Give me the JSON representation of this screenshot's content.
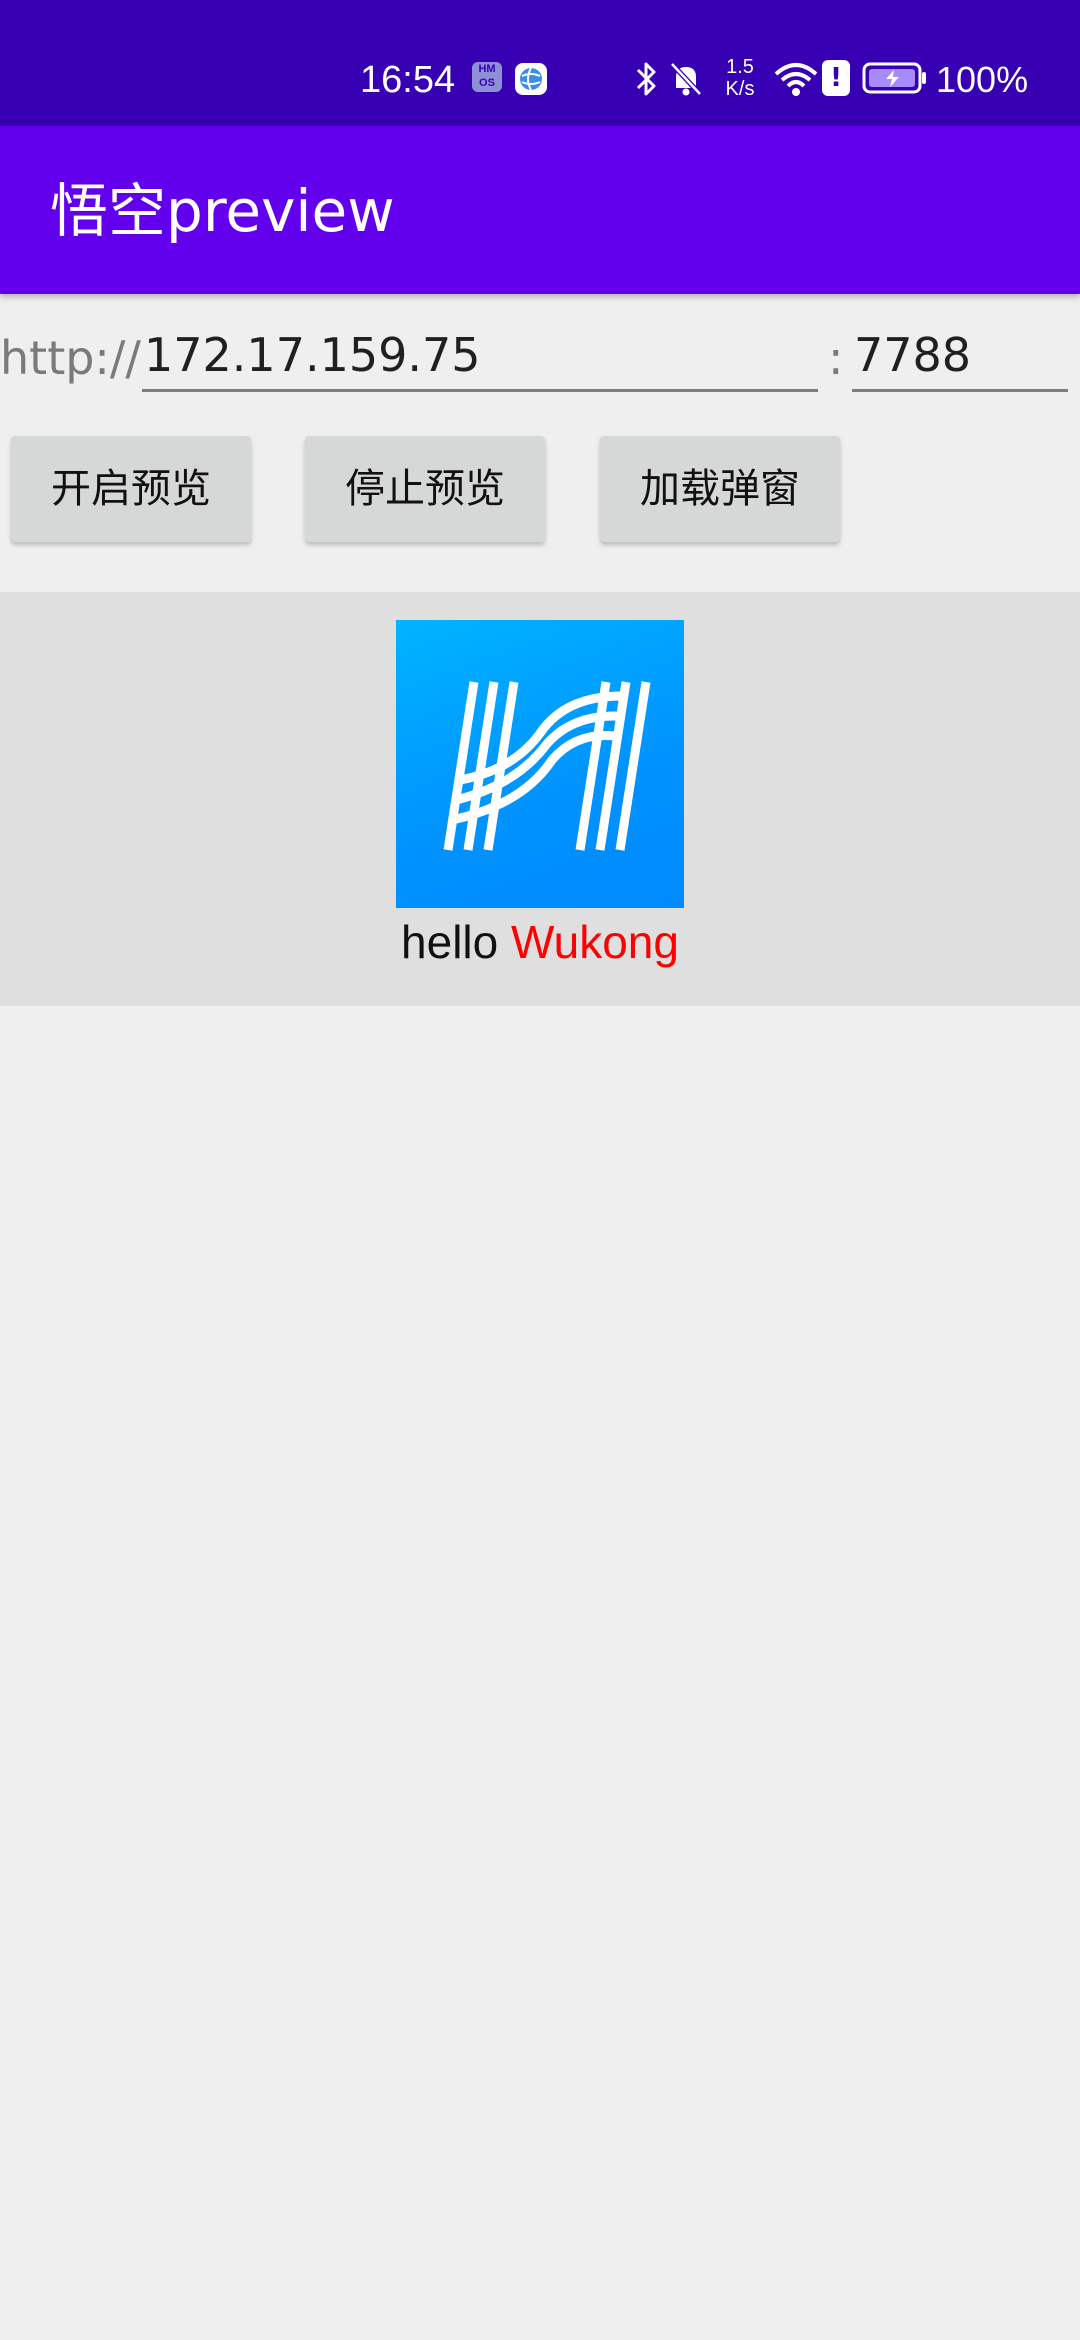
{
  "status_bar": {
    "time": "16:54",
    "hmos_badge": "HM OS",
    "net_speed_value": "1.5",
    "net_speed_unit": "K/s",
    "alert_glyph": "!",
    "battery_percent": "100%",
    "icons": [
      "hmos-icon",
      "globe-app-icon",
      "bluetooth-icon",
      "bell-muted-icon",
      "wifi-icon",
      "alert-icon",
      "battery-charging-icon"
    ]
  },
  "app_bar": {
    "title": "悟空preview"
  },
  "connection": {
    "scheme_prefix": "http://",
    "ip_value": "172.17.159.75",
    "port_separator": ":",
    "port_value": "7788"
  },
  "actions": {
    "start_label": "开启预览",
    "stop_label": "停止预览",
    "dialog_label": "加载弹窗"
  },
  "preview": {
    "logo_icon": "h-logo-icon",
    "hello_word": "hello",
    "wukong_word": "Wukong"
  },
  "colors": {
    "status_bar": "#3700b3",
    "app_bar": "#6200ee",
    "page_background": "#efefef",
    "preview_background": "#dfdfdf",
    "button_background": "#d6d7d7",
    "logo_blue": "#0092ff",
    "wukong_red": "#ff0000"
  }
}
